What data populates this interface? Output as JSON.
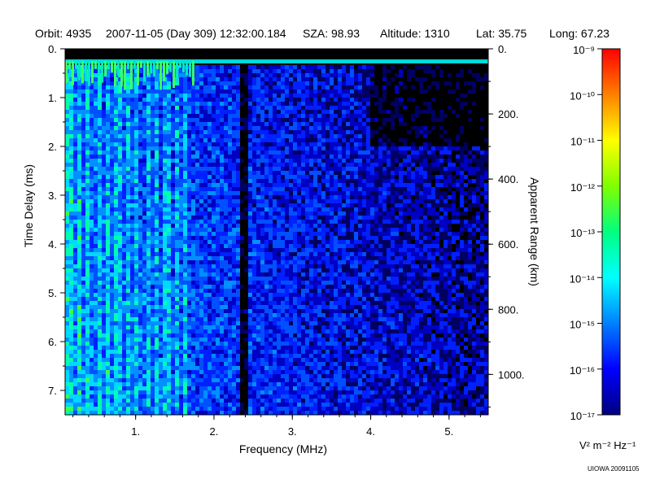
{
  "header": {
    "orbit": "Orbit: 4935",
    "datetime": "2007-11-05 (Day 309) 12:32:00.184",
    "sza": "SZA:  98.93",
    "altitude": "Altitude:     1310",
    "lat": "Lat:  35.75",
    "long": "Long:  67.23"
  },
  "footer": "UIOWA 20091105",
  "chart_data": {
    "type": "heatmap",
    "xlabel": "Frequency (MHz)",
    "ylabel": "Time Delay (ms)",
    "y2label": "Apparent Range (km)",
    "xlim": [
      0.1,
      5.5
    ],
    "ylim": [
      0,
      7.5
    ],
    "y2lim": [
      0,
      1124
    ],
    "x_ticks": [
      "1.",
      "2.",
      "3.",
      "4.",
      "5."
    ],
    "y_ticks": [
      "0.",
      "1.",
      "2.",
      "3.",
      "4.",
      "5.",
      "6.",
      "7."
    ],
    "y2_ticks": [
      "0.",
      "200.",
      "400.",
      "600.",
      "800.",
      "1000."
    ],
    "colorbar": {
      "label": "V² m⁻² Hz⁻¹",
      "scale": "log",
      "range": [
        1e-17,
        1e-09
      ],
      "tick_labels": [
        "10⁻⁹",
        "10⁻¹⁰",
        "10⁻¹¹",
        "10⁻¹²",
        "10⁻¹³",
        "10⁻¹⁴",
        "10⁻¹⁵",
        "10⁻¹⁶",
        "10⁻¹⁷"
      ],
      "colors": [
        "#000080",
        "#0000ff",
        "#0080ff",
        "#00ffff",
        "#00ff80",
        "#80ff00",
        "#ffff00",
        "#ff8000",
        "#ff0000"
      ]
    },
    "features": {
      "surface_reflection_delay_ms": 0.25,
      "surface_reflection_color": "#00ffff",
      "bright_region_max_freq_mhz": 1.75,
      "vertical_gap_freq_mhz": 2.35
    }
  }
}
